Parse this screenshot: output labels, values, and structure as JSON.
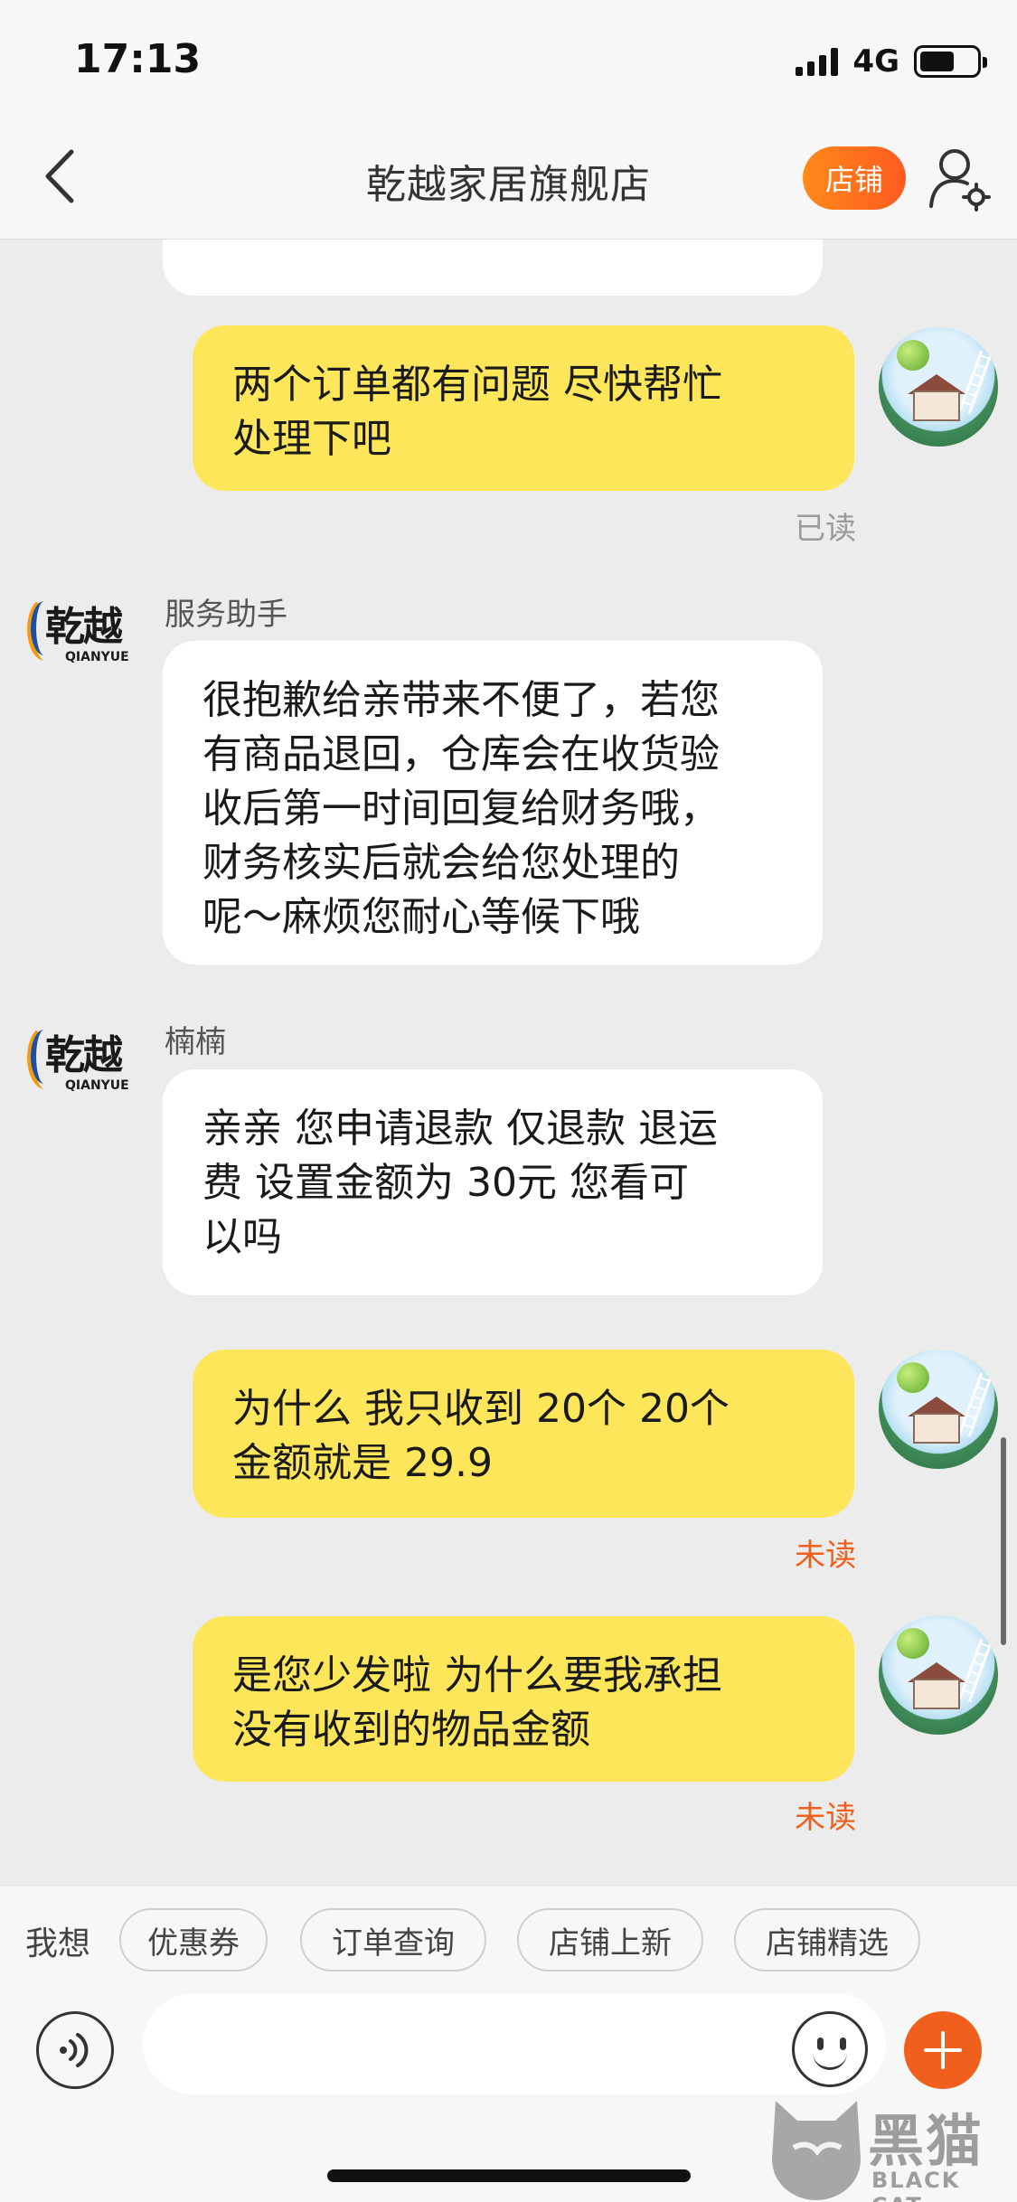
{
  "status_bar": {
    "time": "17:13",
    "network": "4G",
    "battery_level": 0.62
  },
  "nav": {
    "title": "乾越家居旗舰店",
    "shop_button": "店铺",
    "back_icon": "chevron-left-icon",
    "user_settings_icon": "user-settings-icon"
  },
  "messages": [
    {
      "side": "right",
      "text": "两个订单都有问题 尽快帮忙\n处理下吧",
      "read_state": "已读"
    },
    {
      "side": "left",
      "sender": "服务助手",
      "text": "很抱歉给亲带来不便了，若您\n有商品退回，仓库会在收货验\n收后第一时间回复给财务哦，\n财务核实后就会给您处理的\n呢～麻烦您耐心等候下哦"
    },
    {
      "side": "left",
      "sender": "楠楠",
      "text": "亲亲 您申请退款 仅退款  退运\n费  设置金额为 30元 您看可\n以吗"
    },
    {
      "side": "right",
      "text": "为什么 我只收到 20个 20个\n金额就是 29.9",
      "read_state": "未读"
    },
    {
      "side": "right",
      "text": "是您少发啦 为什么要我承担\n没有收到的物品金额",
      "read_state": "未读"
    }
  ],
  "shop_logo": {
    "text": "乾越",
    "sub": "QIANYUE"
  },
  "quick_replies": {
    "label": "我想",
    "items": [
      "优惠券",
      "订单查询",
      "店铺上新",
      "店铺精选"
    ]
  },
  "input": {
    "placeholder": ""
  },
  "watermark": {
    "text": "黑猫",
    "sub": "BLACK CAT"
  },
  "colors": {
    "accent": "#f0601c",
    "bubble_self": "#fde65a",
    "bubble_other": "#ffffff",
    "background": "#ececec"
  }
}
